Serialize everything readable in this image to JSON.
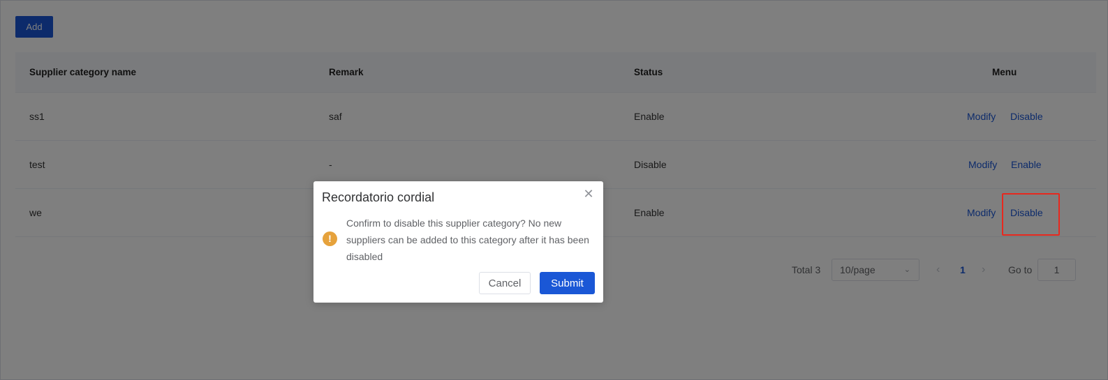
{
  "toolbar": {
    "add_label": "Add"
  },
  "table": {
    "headers": [
      "Supplier category name",
      "Remark",
      "Status",
      "Menu"
    ],
    "rows": [
      {
        "name": "ss1",
        "remark": "saf",
        "status": "Enable",
        "actions": [
          "Modify",
          "Disable"
        ]
      },
      {
        "name": "test",
        "remark": "-",
        "status": "Disable",
        "actions": [
          "Modify",
          "Enable"
        ]
      },
      {
        "name": "we",
        "remark": "",
        "status": "Enable",
        "actions": [
          "Modify",
          "Disable"
        ]
      }
    ]
  },
  "pagination": {
    "total_label": "Total 3",
    "page_size": "10/page",
    "current_page": "1",
    "goto_label": "Go to",
    "goto_value": "1"
  },
  "dialog": {
    "title": "Recordatorio cordial",
    "message": "Confirm to disable this supplier category? No new suppliers can be added to this category after it has been disabled",
    "cancel_label": "Cancel",
    "submit_label": "Submit"
  },
  "colors": {
    "primary": "#1a57d6",
    "warning": "#e6a23c",
    "highlight": "#e8281e"
  },
  "icons": {
    "close": "close-icon",
    "warning": "warning-icon",
    "prev": "chevron-left-icon",
    "next": "chevron-right-icon",
    "dropdown": "chevron-down-icon"
  }
}
